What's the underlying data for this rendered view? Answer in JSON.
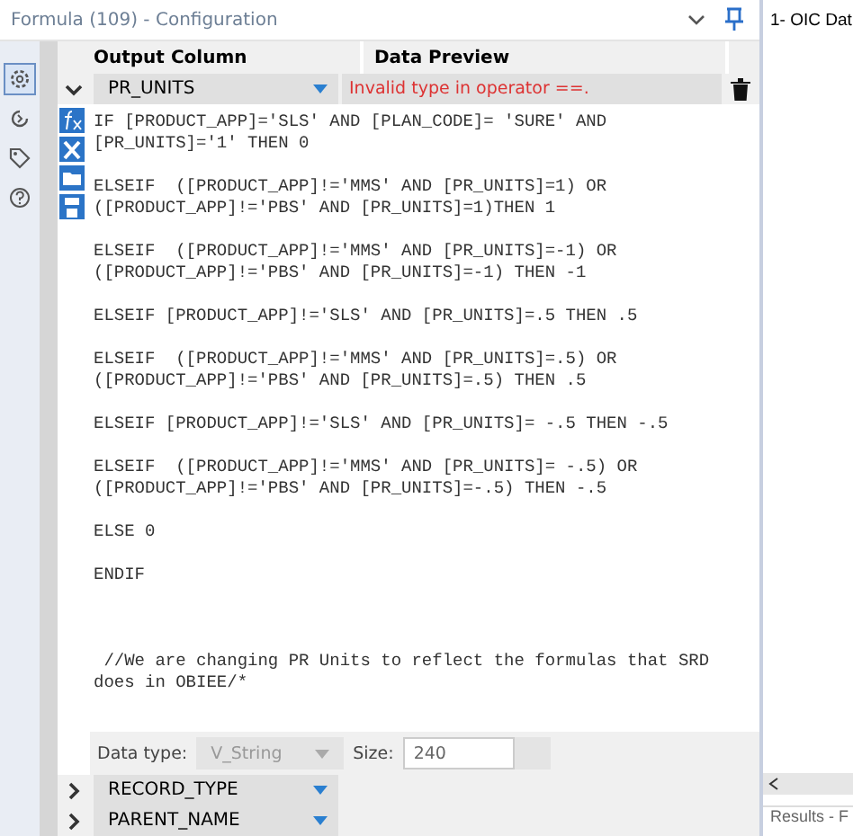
{
  "window": {
    "title": "Formula (109) - Configuration"
  },
  "side_tabs": [
    {
      "selected": true
    },
    {
      "selected": false
    },
    {
      "selected": false
    },
    {
      "selected": false
    }
  ],
  "columns": [
    "Output Column",
    "Data Preview"
  ],
  "fields": [
    {
      "name": "PR_UNITS",
      "expanded": true,
      "preview": "Invalid type in operator ==.",
      "expression": "IF [PRODUCT_APP]='SLS' AND [PLAN_CODE]= 'SURE' AND\n[PR_UNITS]='1' THEN 0\n\nELSEIF  ([PRODUCT_APP]!='MMS' AND [PR_UNITS]=1) OR\n([PRODUCT_APP]!='PBS' AND [PR_UNITS]=1)THEN 1\n\nELSEIF  ([PRODUCT_APP]!='MMS' AND [PR_UNITS]=-1) OR\n([PRODUCT_APP]!='PBS' AND [PR_UNITS]=-1) THEN -1\n\nELSEIF [PRODUCT_APP]!='SLS' AND [PR_UNITS]=.5 THEN .5\n\nELSEIF  ([PRODUCT_APP]!='MMS' AND [PR_UNITS]=.5) OR\n([PRODUCT_APP]!='PBS' AND [PR_UNITS]=.5) THEN .5\n\nELSEIF [PRODUCT_APP]!='SLS' AND [PR_UNITS]= -.5 THEN -.5\n\nELSEIF  ([PRODUCT_APP]!='MMS' AND [PR_UNITS]= -.5) OR\n([PRODUCT_APP]!='PBS' AND [PR_UNITS]=-.5) THEN -.5\n\nELSE 0\n\nENDIF\n\n\n\n //We are changing PR Units to reflect the formulas that SRD\ndoes in OBIEE/*",
      "data_type_label": "Data type:",
      "data_type": "V_String",
      "size_label": "Size:",
      "size": "240"
    },
    {
      "name": "RECORD_TYPE",
      "expanded": false
    },
    {
      "name": "PARENT_NAME",
      "expanded": false
    }
  ],
  "right_panel": {
    "title": "1- OIC Dat",
    "footer": "Results - F"
  }
}
